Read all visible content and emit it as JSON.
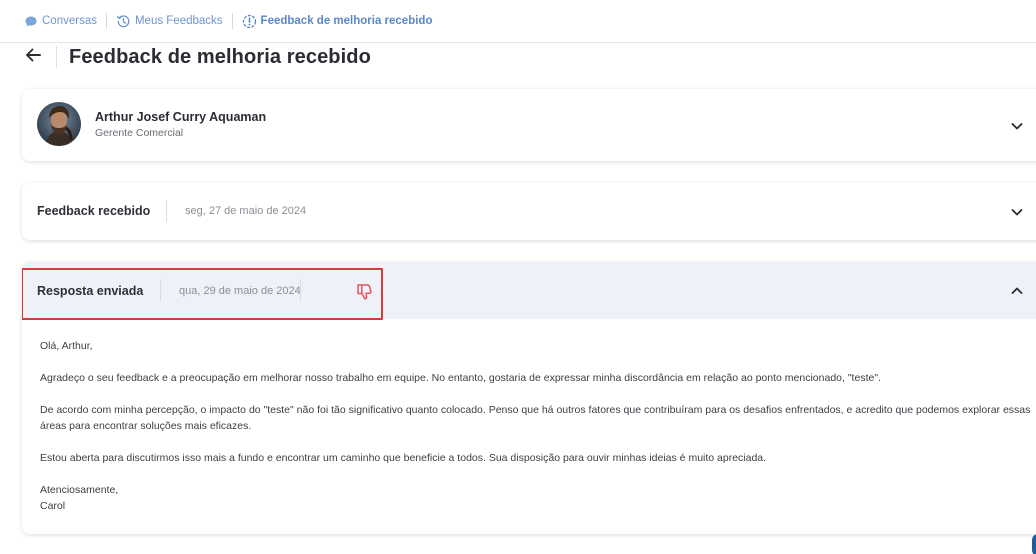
{
  "breadcrumb": {
    "items": [
      {
        "label": "Conversas",
        "icon": "chat-bubble-icon"
      },
      {
        "label": "Meus Feedbacks",
        "icon": "history-icon"
      },
      {
        "label": "Feedback de melhoria recebido",
        "icon": "alert-circle-icon"
      }
    ]
  },
  "header": {
    "back_icon": "arrow-left-icon",
    "title": "Feedback de melhoria recebido"
  },
  "person": {
    "name": "Arthur Josef Curry Aquaman",
    "role": "Gerente Comercial"
  },
  "received": {
    "label": "Feedback recebido",
    "date": "seg, 27 de maio de 2024"
  },
  "response": {
    "label": "Resposta enviada",
    "date": "qua, 29 de maio de 2024",
    "reaction_icon": "thumbs-down-icon",
    "body": {
      "greeting": "Olá, Arthur,",
      "paragraph1": "Agradeço o seu feedback e a preocupação em melhorar nosso trabalho em equipe. No entanto, gostaria de expressar minha discordância em relação ao ponto mencionado, \"teste\".",
      "paragraph2": "De acordo com minha percepção, o impacto do \"teste\" não foi tão significativo quanto colocado. Penso que há outros fatores que contribuíram para os desafios enfrentados, e acredito que podemos explorar essas áreas para encontrar soluções mais eficazes.",
      "paragraph3": "Estou aberta para discutirmos isso mais a fundo e encontrar um caminho que beneficie a todos. Sua disposição para ouvir minhas ideias é muito apreciada.",
      "signoff": "Atenciosamente,",
      "signature": "Carol"
    }
  },
  "colors": {
    "accent": "#5b86c8",
    "highlight_border": "#d63a3d",
    "thumb_down": "#e2565f",
    "header_bg": "#eff1f8"
  }
}
